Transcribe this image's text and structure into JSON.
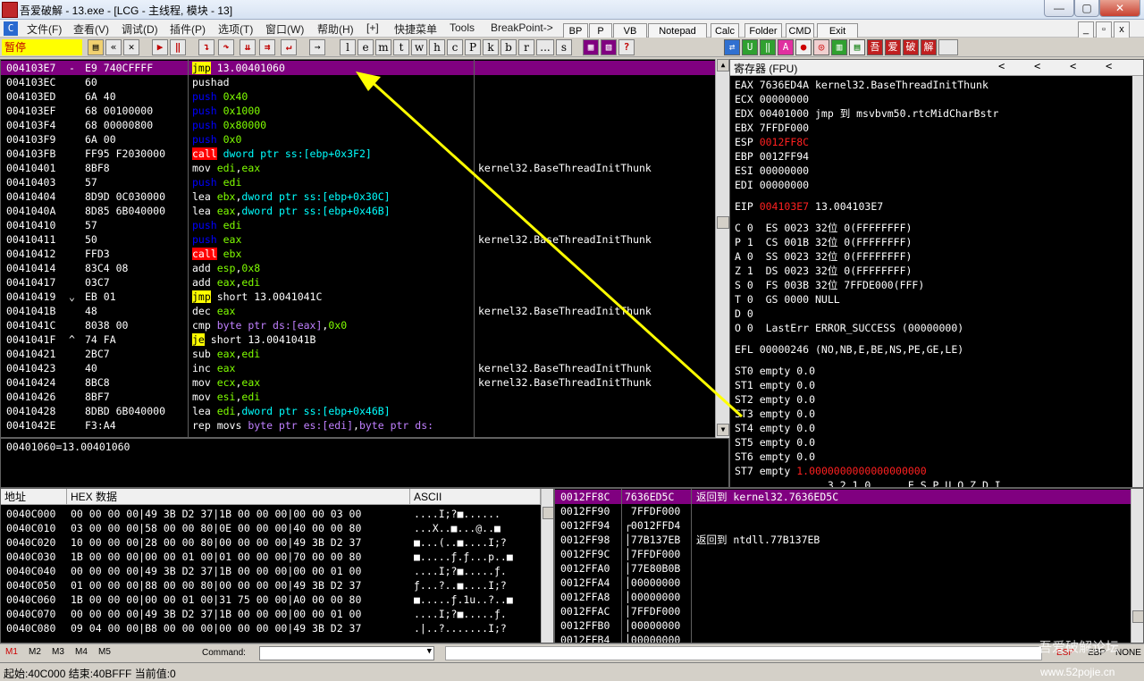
{
  "window": {
    "title": "吾爱破解 - 13.exe - [LCG - 主线程, 模块 - 13]",
    "minimize": "—",
    "maximize": "▢",
    "close": "✕"
  },
  "menu": [
    "文件(F)",
    "查看(V)",
    "调试(D)",
    "插件(P)",
    "选项(T)",
    "窗口(W)",
    "帮助(H)",
    "[+]",
    "快捷菜单",
    "Tools",
    "BreakPoint->"
  ],
  "quick_buttons": [
    "BP",
    "P",
    "VB",
    "Notepad",
    "Calc",
    "Folder",
    "CMD",
    "Exit"
  ],
  "toolbar": {
    "status": "暂停",
    "letters": [
      "l",
      "e",
      "m",
      "t",
      "w",
      "h",
      "c",
      "P",
      "k",
      "b",
      "r",
      "...",
      "s"
    ]
  },
  "cpu": {
    "rows": [
      {
        "addr": "004103E7",
        "mark": "-",
        "hex": "E9 740CFFFF",
        "mn": "jmp",
        "mnClass": "mn-jmp",
        "ops": [
          {
            "t": " 13.00401060",
            "c": ""
          }
        ],
        "cmt": "",
        "sel": true
      },
      {
        "addr": "004103EC",
        "mark": "",
        "hex": "60",
        "mn": "pushad",
        "mnClass": "",
        "ops": [],
        "cmt": ""
      },
      {
        "addr": "004103ED",
        "mark": "",
        "hex": "6A 40",
        "mn": "push",
        "mnClass": "mn-push",
        "ops": [
          {
            "t": " 0x40",
            "c": "op-num"
          }
        ],
        "cmt": ""
      },
      {
        "addr": "004103EF",
        "mark": "",
        "hex": "68 00100000",
        "mn": "push",
        "mnClass": "mn-push",
        "ops": [
          {
            "t": " 0x1000",
            "c": "op-num"
          }
        ],
        "cmt": ""
      },
      {
        "addr": "004103F4",
        "mark": "",
        "hex": "68 00000800",
        "mn": "push",
        "mnClass": "mn-push",
        "ops": [
          {
            "t": " 0x80000",
            "c": "op-num"
          }
        ],
        "cmt": ""
      },
      {
        "addr": "004103F9",
        "mark": "",
        "hex": "6A 00",
        "mn": "push",
        "mnClass": "mn-push",
        "ops": [
          {
            "t": " 0x0",
            "c": "op-num"
          }
        ],
        "cmt": ""
      },
      {
        "addr": "004103FB",
        "mark": "",
        "hex": "FF95 F2030000",
        "mn": "call",
        "mnClass": "mn-call",
        "ops": [
          {
            "t": " dword ptr ss:[ebp+0x3F2]",
            "c": "op-mem"
          }
        ],
        "cmt": ""
      },
      {
        "addr": "00410401",
        "mark": "",
        "hex": "8BF8",
        "mn": "mov",
        "mnClass": "",
        "ops": [
          {
            "t": " edi",
            "c": "op-reg"
          },
          {
            "t": ",",
            "c": ""
          },
          {
            "t": "eax",
            "c": "op-reg"
          }
        ],
        "cmt": "kernel32.BaseThreadInitThunk"
      },
      {
        "addr": "00410403",
        "mark": "",
        "hex": "57",
        "mn": "push",
        "mnClass": "mn-push",
        "ops": [
          {
            "t": " edi",
            "c": "op-reg"
          }
        ],
        "cmt": ""
      },
      {
        "addr": "00410404",
        "mark": "",
        "hex": "8D9D 0C030000",
        "mn": "lea",
        "mnClass": "",
        "ops": [
          {
            "t": " ebx",
            "c": "op-reg"
          },
          {
            "t": ",",
            "c": ""
          },
          {
            "t": "dword ptr ss:[ebp+0x30C]",
            "c": "op-mem"
          }
        ],
        "cmt": ""
      },
      {
        "addr": "0041040A",
        "mark": "",
        "hex": "8D85 6B040000",
        "mn": "lea",
        "mnClass": "",
        "ops": [
          {
            "t": " eax",
            "c": "op-reg"
          },
          {
            "t": ",",
            "c": ""
          },
          {
            "t": "dword ptr ss:[ebp+0x46B]",
            "c": "op-mem"
          }
        ],
        "cmt": ""
      },
      {
        "addr": "00410410",
        "mark": "",
        "hex": "57",
        "mn": "push",
        "mnClass": "mn-push",
        "ops": [
          {
            "t": " edi",
            "c": "op-reg"
          }
        ],
        "cmt": ""
      },
      {
        "addr": "00410411",
        "mark": "",
        "hex": "50",
        "mn": "push",
        "mnClass": "mn-push",
        "ops": [
          {
            "t": " eax",
            "c": "op-reg"
          }
        ],
        "cmt": "kernel32.BaseThreadInitThunk"
      },
      {
        "addr": "00410412",
        "mark": "",
        "hex": "FFD3",
        "mn": "call",
        "mnClass": "mn-call",
        "ops": [
          {
            "t": " ebx",
            "c": "op-reg"
          }
        ],
        "cmt": ""
      },
      {
        "addr": "00410414",
        "mark": "",
        "hex": "83C4 08",
        "mn": "add",
        "mnClass": "",
        "ops": [
          {
            "t": " esp",
            "c": "op-reg"
          },
          {
            "t": ",",
            "c": ""
          },
          {
            "t": "0x8",
            "c": "op-num"
          }
        ],
        "cmt": ""
      },
      {
        "addr": "00410417",
        "mark": "",
        "hex": "03C7",
        "mn": "add",
        "mnClass": "",
        "ops": [
          {
            "t": " eax",
            "c": "op-reg"
          },
          {
            "t": ",",
            "c": ""
          },
          {
            "t": "edi",
            "c": "op-reg"
          }
        ],
        "cmt": ""
      },
      {
        "addr": "00410419",
        "mark": "⌄",
        "hex": "EB 01",
        "mn": "jmp",
        "mnClass": "mn-jmp",
        "ops": [
          {
            "t": " short 13.0041041C",
            "c": ""
          }
        ],
        "cmt": ""
      },
      {
        "addr": "0041041B",
        "mark": "",
        "hex": "48",
        "mn": "dec",
        "mnClass": "mn-dec",
        "ops": [
          {
            "t": " eax",
            "c": "op-reg"
          }
        ],
        "cmt": "kernel32.BaseThreadInitThunk"
      },
      {
        "addr": "0041041C",
        "mark": "",
        "hex": "8038 00",
        "mn": "cmp",
        "mnClass": "",
        "ops": [
          {
            "t": " byte ptr ds:[eax]",
            "c": "op-data"
          },
          {
            "t": ",",
            "c": ""
          },
          {
            "t": "0x0",
            "c": "op-num"
          }
        ],
        "cmt": ""
      },
      {
        "addr": "0041041F",
        "mark": "^",
        "hex": "74 FA",
        "mn": "je",
        "mnClass": "mn-jmp",
        "ops": [
          {
            "t": " short 13.0041041B",
            "c": ""
          }
        ],
        "cmt": ""
      },
      {
        "addr": "00410421",
        "mark": "",
        "hex": "2BC7",
        "mn": "sub",
        "mnClass": "",
        "ops": [
          {
            "t": " eax",
            "c": "op-reg"
          },
          {
            "t": ",",
            "c": ""
          },
          {
            "t": "edi",
            "c": "op-reg"
          }
        ],
        "cmt": ""
      },
      {
        "addr": "00410423",
        "mark": "",
        "hex": "40",
        "mn": "inc",
        "mnClass": "",
        "ops": [
          {
            "t": " eax",
            "c": "op-reg"
          }
        ],
        "cmt": "kernel32.BaseThreadInitThunk"
      },
      {
        "addr": "00410424",
        "mark": "",
        "hex": "8BC8",
        "mn": "mov",
        "mnClass": "",
        "ops": [
          {
            "t": " ecx",
            "c": "op-reg"
          },
          {
            "t": ",",
            "c": ""
          },
          {
            "t": "eax",
            "c": "op-reg"
          }
        ],
        "cmt": "kernel32.BaseThreadInitThunk"
      },
      {
        "addr": "00410426",
        "mark": "",
        "hex": "8BF7",
        "mn": "mov",
        "mnClass": "",
        "ops": [
          {
            "t": " esi",
            "c": "op-reg"
          },
          {
            "t": ",",
            "c": ""
          },
          {
            "t": "edi",
            "c": "op-reg"
          }
        ],
        "cmt": ""
      },
      {
        "addr": "00410428",
        "mark": "",
        "hex": "8DBD 6B040000",
        "mn": "lea",
        "mnClass": "",
        "ops": [
          {
            "t": " edi",
            "c": "op-reg"
          },
          {
            "t": ",",
            "c": ""
          },
          {
            "t": "dword ptr ss:[ebp+0x46B]",
            "c": "op-mem"
          }
        ],
        "cmt": ""
      },
      {
        "addr": "0041042E",
        "mark": "",
        "hex": "F3:A4",
        "mn": "rep movs",
        "mnClass": "",
        "ops": [
          {
            "t": " byte ptr es:[edi]",
            "c": "op-data"
          },
          {
            "t": ",",
            "c": ""
          },
          {
            "t": "byte ptr ds:",
            "c": "op-data"
          }
        ],
        "cmt": ""
      }
    ]
  },
  "info_line": "00401060=13.00401060",
  "registers": {
    "header": "寄存器 (FPU)",
    "header_arrows": [
      "<",
      "<",
      "<",
      "<"
    ],
    "lines": [
      {
        "t": "EAX 7636ED4A kernel32.BaseThreadInitThunk",
        "red": ""
      },
      {
        "t": "ECX 00000000",
        "red": ""
      },
      {
        "t": "EDX 00401000 jmp 到 msvbvm50.rtcMidCharBstr",
        "red": ""
      },
      {
        "t": "EBX 7FFDF000",
        "red": ""
      },
      {
        "t": "ESP ",
        "red": "0012FF8C"
      },
      {
        "t": "EBP 0012FF94",
        "red": ""
      },
      {
        "t": "ESI 00000000",
        "red": ""
      },
      {
        "t": "EDI 00000000",
        "red": ""
      },
      {
        "t": "",
        "red": ""
      },
      {
        "t": "EIP ",
        "red": "004103E7",
        "tail": " 13.004103E7"
      },
      {
        "t": "",
        "red": ""
      },
      {
        "t": "C 0  ES 0023 32位 0(FFFFFFFF)",
        "red": ""
      },
      {
        "t": "P 1  CS 001B 32位 0(FFFFFFFF)",
        "red": ""
      },
      {
        "t": "A 0  SS 0023 32位 0(FFFFFFFF)",
        "red": ""
      },
      {
        "t": "Z 1  DS 0023 32位 0(FFFFFFFF)",
        "red": ""
      },
      {
        "t": "S 0  FS 003B 32位 7FFDE000(FFF)",
        "red": ""
      },
      {
        "t": "T 0  GS 0000 NULL",
        "red": ""
      },
      {
        "t": "D 0",
        "red": ""
      },
      {
        "t": "O 0  LastErr ERROR_SUCCESS (00000000)",
        "red": ""
      },
      {
        "t": "",
        "red": ""
      },
      {
        "t": "EFL 00000246 (NO,NB,E,BE,NS,PE,GE,LE)",
        "red": ""
      },
      {
        "t": "",
        "red": ""
      },
      {
        "t": "ST0 empty 0.0",
        "red": ""
      },
      {
        "t": "ST1 empty 0.0",
        "red": ""
      },
      {
        "t": "ST2 empty 0.0",
        "red": ""
      },
      {
        "t": "ST3 empty 0.0",
        "red": ""
      },
      {
        "t": "ST4 empty 0.0",
        "red": ""
      },
      {
        "t": "ST5 empty 0.0",
        "red": ""
      },
      {
        "t": "ST6 empty 0.0",
        "red": ""
      },
      {
        "t": "ST7 empty ",
        "red": "1.0000000000000000000"
      },
      {
        "t": "               3 2 1 0      E S P U O Z D I",
        "red": ""
      }
    ]
  },
  "dump": {
    "headers": [
      "地址",
      "HEX 数据",
      "ASCII"
    ],
    "rows": [
      {
        "addr": "0040C000",
        "hex": "00 00 00 00|49 3B D2 37|1B 00 00 00|00 00 03 00",
        "ascii": "....I;?■......"
      },
      {
        "addr": "0040C010",
        "hex": "03 00 00 00|58 00 00 80|0E 00 00 00|40 00 00 80",
        "ascii": "...X..■...@..■"
      },
      {
        "addr": "0040C020",
        "hex": "10 00 00 00|28 00 00 80|00 00 00 00|49 3B D2 37",
        "ascii": "■...(..■....I;?"
      },
      {
        "addr": "0040C030",
        "hex": "1B 00 00 00|00 00 01 00|01 00 00 00|70 00 00 80",
        "ascii": "■.....ƒ.ƒ...p..■"
      },
      {
        "addr": "0040C040",
        "hex": "00 00 00 00|49 3B D2 37|1B 00 00 00|00 00 01 00",
        "ascii": "....I;?■.....ƒ."
      },
      {
        "addr": "0040C050",
        "hex": "01 00 00 00|88 00 00 80|00 00 00 00|49 3B D2 37",
        "ascii": "ƒ...?..■....I;?"
      },
      {
        "addr": "0040C060",
        "hex": "1B 00 00 00|00 00 01 00|31 75 00 00|A0 00 00 80",
        "ascii": "■.....ƒ.1u..?..■"
      },
      {
        "addr": "0040C070",
        "hex": "00 00 00 00|49 3B D2 37|1B 00 00 00|00 00 01 00",
        "ascii": "....I;?■.....ƒ."
      },
      {
        "addr": "0040C080",
        "hex": "09 04 00 00|B8 00 00 00|00 00 00 00|49 3B D2 37",
        "ascii": ".|..?.......I;?"
      }
    ]
  },
  "stack": {
    "rows": [
      {
        "addr": "0012FF8C",
        "val": "7636ED5C",
        "note": "返回到 kernel32.7636ED5C",
        "sel": true
      },
      {
        "addr": "0012FF90",
        "val": " 7FFDF000",
        "note": ""
      },
      {
        "addr": "0012FF94",
        "val": "┌0012FFD4",
        "note": ""
      },
      {
        "addr": "0012FF98",
        "val": "│77B137EB",
        "note": "返回到 ntdll.77B137EB"
      },
      {
        "addr": "0012FF9C",
        "val": "│7FFDF000",
        "note": ""
      },
      {
        "addr": "0012FFA0",
        "val": "│77E80B0B",
        "note": ""
      },
      {
        "addr": "0012FFA4",
        "val": "│00000000",
        "note": ""
      },
      {
        "addr": "0012FFA8",
        "val": "│00000000",
        "note": ""
      },
      {
        "addr": "0012FFAC",
        "val": "│7FFDF000",
        "note": ""
      },
      {
        "addr": "0012FFB0",
        "val": "│00000000",
        "note": ""
      },
      {
        "addr": "0012FFB4",
        "val": "│00000000",
        "note": ""
      }
    ]
  },
  "bottom": {
    "mtabs": [
      "M1",
      "M2",
      "M3",
      "M4",
      "M5"
    ],
    "command_label": "Command:",
    "flags": [
      "ESP",
      "EBP",
      "NONE"
    ],
    "watermark": "吾爱破解论坛",
    "watermark_url": "www.52pojie.cn"
  },
  "status": "起始:40C000 结束:40BFFF 当前值:0",
  "colors": {
    "selection": "#800080",
    "arrow": "#ffff00"
  }
}
